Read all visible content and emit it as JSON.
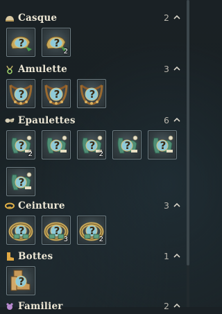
{
  "categories": [
    {
      "key": "casque",
      "label": "Casque",
      "count": "2",
      "icon": "helmet-icon",
      "items": [
        {
          "type": "helmet",
          "qty": ""
        },
        {
          "type": "helmet",
          "qty": "2"
        }
      ]
    },
    {
      "key": "amulette",
      "label": "Amulette",
      "count": "3",
      "icon": "amulet-icon",
      "items": [
        {
          "type": "amulet",
          "qty": ""
        },
        {
          "type": "amulet",
          "qty": ""
        },
        {
          "type": "amulet",
          "qty": ""
        }
      ]
    },
    {
      "key": "epaulettes",
      "label": "Epaulettes",
      "count": "6",
      "icon": "epaulettes-icon",
      "items": [
        {
          "type": "epaulette",
          "qty": "2"
        },
        {
          "type": "epaulette",
          "qty": ""
        },
        {
          "type": "epaulette",
          "qty": "2"
        },
        {
          "type": "epaulette",
          "qty": ""
        },
        {
          "type": "epaulette",
          "qty": ""
        },
        {
          "type": "epaulette",
          "qty": ""
        }
      ]
    },
    {
      "key": "ceinture",
      "label": "Ceinture",
      "count": "3",
      "icon": "belt-icon",
      "items": [
        {
          "type": "belt",
          "qty": ""
        },
        {
          "type": "belt",
          "qty": "3"
        },
        {
          "type": "belt",
          "qty": "2"
        }
      ]
    },
    {
      "key": "bottes",
      "label": "Bottes",
      "count": "1",
      "icon": "boots-icon",
      "items": [
        {
          "type": "boots",
          "qty": ""
        }
      ]
    },
    {
      "key": "familier",
      "label": "Familier",
      "count": "2",
      "icon": "pet-icon",
      "items": []
    }
  ],
  "colors": {
    "label": "#ece6d4",
    "count": "#b9b6ad",
    "accent_gold": "#e6c46a",
    "item_border": "#6f7e84",
    "question_mark": "#3b2a12"
  }
}
